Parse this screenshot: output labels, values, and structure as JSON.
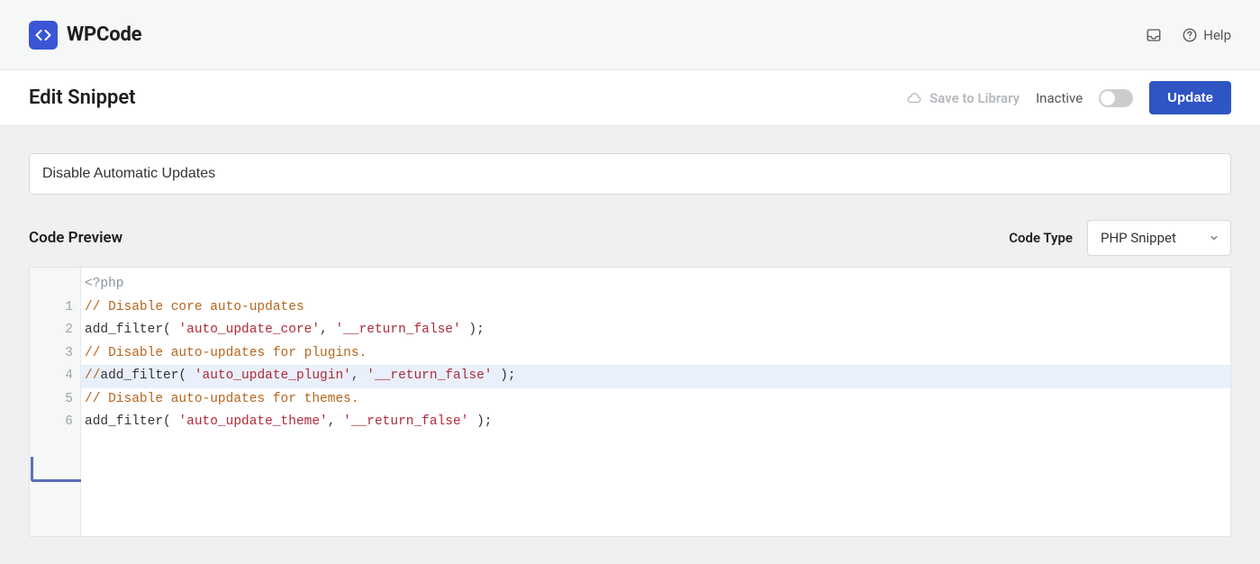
{
  "brand": {
    "name": "WPCode"
  },
  "top_actions": {
    "help_label": "Help"
  },
  "action_bar": {
    "title": "Edit Snippet",
    "save_library": "Save to Library",
    "status_label": "Inactive",
    "update_label": "Update"
  },
  "snippet": {
    "title_value": "Disable Automatic Updates",
    "preview_label": "Code Preview",
    "code_type_label": "Code Type",
    "code_type_value": "PHP Snippet"
  },
  "code": {
    "php_open": "<?php",
    "lines": [
      {
        "n": 1,
        "type": "comment",
        "text": "// Disable core auto-updates"
      },
      {
        "n": 2,
        "type": "call",
        "func": "add_filter",
        "arg1": "'auto_update_core'",
        "arg2": "'__return_false'"
      },
      {
        "n": 3,
        "type": "comment",
        "text": "// Disable auto-updates for plugins."
      },
      {
        "n": 4,
        "type": "call_commented",
        "prefix": "//",
        "func": "add_filter",
        "arg1": "'auto_update_plugin'",
        "arg2": "'__return_false'",
        "active": true
      },
      {
        "n": 5,
        "type": "comment",
        "text": "// Disable auto-updates for themes."
      },
      {
        "n": 6,
        "type": "call",
        "func": "add_filter",
        "arg1": "'auto_update_theme'",
        "arg2": "'__return_false'"
      }
    ]
  }
}
